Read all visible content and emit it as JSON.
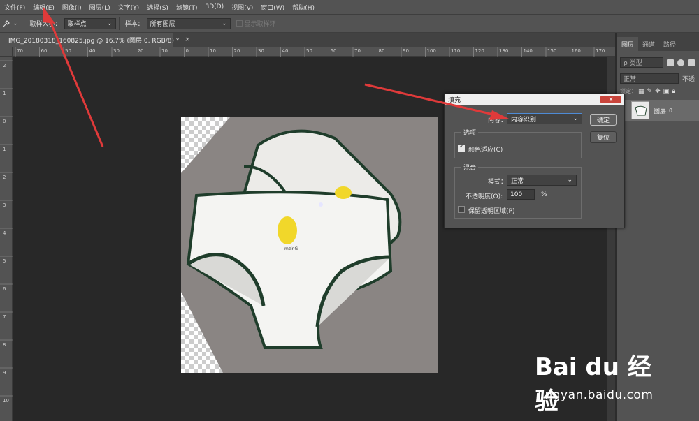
{
  "menu": {
    "items": [
      "文件(F)",
      "编辑(E)",
      "图像(I)",
      "图层(L)",
      "文字(Y)",
      "选择(S)",
      "滤镜(T)",
      "3D(D)",
      "视图(V)",
      "窗口(W)",
      "帮助(H)"
    ]
  },
  "options": {
    "sample_size_label": "取样大小：",
    "sample_size_value": "取样点",
    "sample_label": "样本：",
    "sample_value": "所有图层",
    "show_ring_label": "显示取样环"
  },
  "document": {
    "tab_title": "IMG_20180318_160825.jpg @ 16.7% (图层 0, RGB/8) *",
    "close_symbol": "×"
  },
  "ruler": {
    "top_ticks": [
      "70",
      "60",
      "50",
      "40",
      "30",
      "20",
      "10",
      "0",
      "10",
      "20",
      "30",
      "40",
      "50",
      "60",
      "70",
      "80",
      "90",
      "100",
      "110",
      "120",
      "130",
      "140",
      "150",
      "160",
      "170"
    ],
    "left_ticks": [
      "2",
      "1",
      "0",
      "1",
      "2",
      "3",
      "4",
      "5",
      "6",
      "7",
      "8",
      "9",
      "10"
    ]
  },
  "layers_panel": {
    "tabs": [
      "图层",
      "通道",
      "路径"
    ],
    "filter_placeholder": "ρ 类型",
    "blend_mode": "正常",
    "opacity_label": "不透",
    "lock_label": "锁定：",
    "layer_name": "图层",
    "layer_number": "0"
  },
  "fill_dialog": {
    "title": "填充",
    "close_label": "×",
    "contents_label": "内容：",
    "contents_value": "内容识别",
    "ok_label": "确定",
    "reset_label": "复位",
    "options_group": "选项",
    "color_adapt_label": "颜色适应(C)",
    "color_adapt_checked": true,
    "blend_group": "混合",
    "mode_label": "模式：",
    "mode_value": "正常",
    "opacity_label": "不透明度(O):",
    "opacity_value": "100",
    "opacity_unit": "%",
    "preserve_label": "保留透明区域(P)",
    "preserve_checked": false
  },
  "watermark": {
    "logo": "Bai du 经验",
    "url": "jingyan.baidu.com"
  },
  "colors": {
    "arrow": "#e03a3a",
    "panel_bg": "#535353",
    "canvas_bg": "#282828",
    "accent_border": "#4e8bd6"
  }
}
